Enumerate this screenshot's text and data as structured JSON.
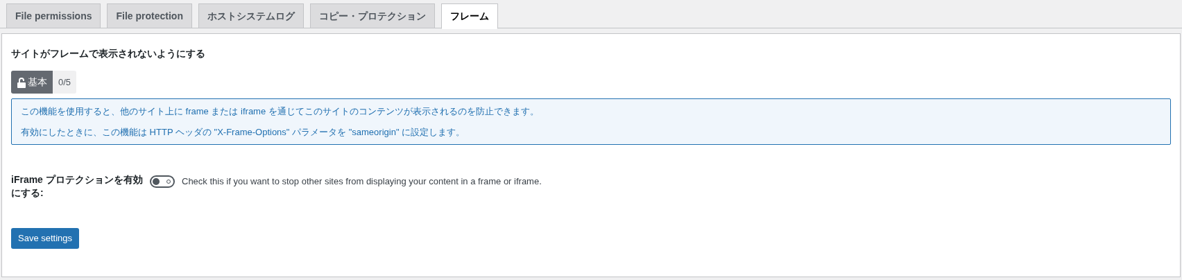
{
  "tabs": [
    {
      "label": "File permissions",
      "selected": false
    },
    {
      "label": "File protection",
      "selected": false
    },
    {
      "label": "ホストシステムログ",
      "selected": false
    },
    {
      "label": "コピー・プロテクション",
      "selected": false
    },
    {
      "label": "フレーム",
      "selected": true
    }
  ],
  "section_title": "サイトがフレームで表示されないようにする",
  "badge": {
    "label": "基本",
    "count": "0/5"
  },
  "info": [
    "この機能を使用すると、他のサイト上に frame または iframe を通じてこのサイトのコンテンツが表示されるのを防止できます。",
    "有効にしたときに、この機能は HTTP ヘッダの \"X-Frame-Options\" パラメータを \"sameorigin\" に設定します。"
  ],
  "setting": {
    "label": "iFrame プロテクションを有効にする:",
    "on": false,
    "description": "Check this if you want to stop other sites from displaying your content in a frame or iframe."
  },
  "save_button": "Save settings"
}
